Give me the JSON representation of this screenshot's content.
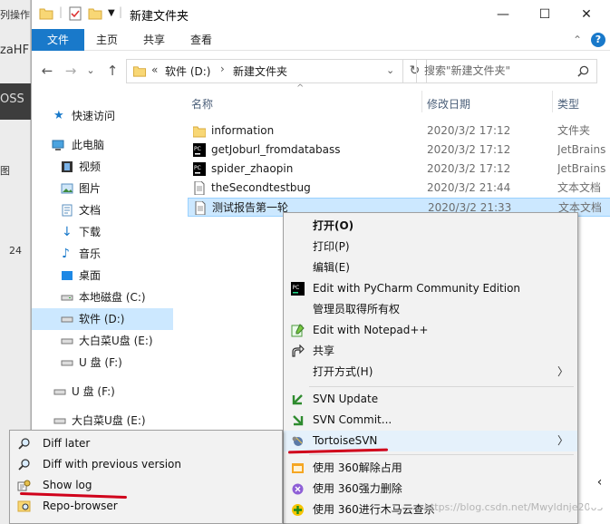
{
  "background_app": {
    "fragments": [
      "列操作",
      "zaHF",
      "OSS",
      "图",
      "24"
    ]
  },
  "window": {
    "title": "新建文件夹",
    "controls": {
      "minimize": "—",
      "maximize": "☐",
      "close": "✕"
    }
  },
  "ribbon": {
    "tabs": [
      "文件",
      "主页",
      "共享",
      "查看"
    ],
    "collapse_glyph": "⌃",
    "help_glyph": "?",
    "accent": "#1979ca"
  },
  "address": {
    "back": "←",
    "forward": "→",
    "dropdown": "⌄",
    "up": "↑",
    "prefix": "«",
    "crumbs": [
      "软件 (D:)",
      "新建文件夹"
    ],
    "refresh": "↻",
    "search_placeholder": "搜索\"新建文件夹\""
  },
  "nav": {
    "quick_access": "快速访问",
    "this_pc": "此电脑",
    "items": [
      "视频",
      "图片",
      "文档",
      "下载",
      "音乐",
      "桌面",
      "本地磁盘 (C:)",
      "软件 (D:)",
      "大白菜U盘 (E:)",
      "U 盘 (F:)",
      "U 盘 (F:)",
      "大白菜U盘 (E:)"
    ]
  },
  "columns": {
    "name": "名称",
    "date": "修改日期",
    "type": "类型"
  },
  "files": [
    {
      "name": "information",
      "date": "2020/3/2 17:12",
      "type": "文件夹",
      "icon": "folder-icon"
    },
    {
      "name": "getJoburl_fromdatabass",
      "date": "2020/3/2 17:12",
      "type": "JetBrains",
      "icon": "pycharm-file-icon"
    },
    {
      "name": "spider_zhaopin",
      "date": "2020/3/2 17:12",
      "type": "JetBrains",
      "icon": "pycharm-file-icon"
    },
    {
      "name": "theSecondtestbug",
      "date": "2020/3/2 21:44",
      "type": "文本文档",
      "icon": "text-file-icon"
    },
    {
      "name": "测试报告第一轮",
      "date": "2020/3/2 21:33",
      "type": "文本文档",
      "icon": "text-file-icon"
    }
  ],
  "context_menu": {
    "items": [
      {
        "label": "打开(O)",
        "bold": true
      },
      {
        "label": "打印(P)"
      },
      {
        "label": "编辑(E)"
      },
      {
        "label": "Edit with PyCharm Community Edition"
      },
      {
        "label": "管理员取得所有权"
      },
      {
        "label": "Edit with Notepad++"
      },
      {
        "label": "共享"
      },
      {
        "label": "打开方式(H)"
      },
      {
        "label": "SVN Update"
      },
      {
        "label": "SVN Commit..."
      },
      {
        "label": "TortoiseSVN"
      },
      {
        "label": "使用 360解除占用"
      },
      {
        "label": "使用 360强力删除"
      },
      {
        "label": "使用 360进行木马云查杀"
      }
    ],
    "submenu_arrow": "〉"
  },
  "svn_submenu": {
    "items": [
      "Diff later",
      "Diff with previous version",
      "Show log",
      "Repo-browser"
    ]
  },
  "watermark": "https://blog.csdn.net/Mwyldnje2003",
  "right_handle": "‹"
}
